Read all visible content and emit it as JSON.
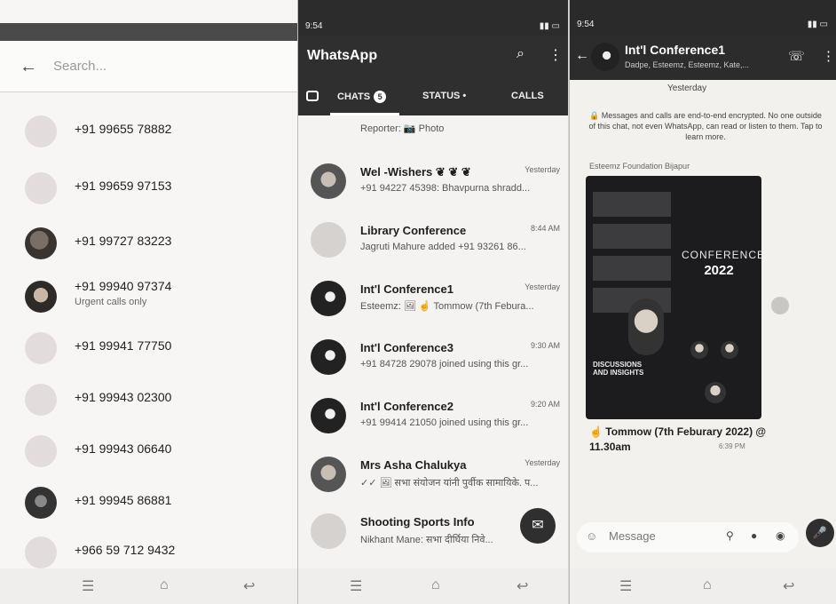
{
  "contacts_panel": {
    "search_placeholder": "Search...",
    "back_icon": "←",
    "contacts": [
      {
        "number": "+91 99655 78882",
        "subtitle": ""
      },
      {
        "number": "+91 99659 97153",
        "subtitle": ""
      },
      {
        "number": "+91 99727 83223",
        "subtitle": ""
      },
      {
        "number": "+91 99940 97374",
        "subtitle": "Urgent calls only"
      },
      {
        "number": "+91 99941 77750",
        "subtitle": ""
      },
      {
        "number": "+91 99943 02300",
        "subtitle": ""
      },
      {
        "number": "+91 99943 06640",
        "subtitle": ""
      },
      {
        "number": "+91 99945 86881",
        "subtitle": ""
      },
      {
        "number": "+966 59 712 9432",
        "subtitle": ""
      }
    ]
  },
  "chats_panel": {
    "status_time": "9:54",
    "app_title": "WhatsApp",
    "tabs": {
      "chats": "CHATS",
      "chats_badge": "5",
      "status": "STATUS •",
      "calls": "CALLS"
    },
    "chats": [
      {
        "name": "",
        "time": "",
        "last": "Reporter: 📷 Photo"
      },
      {
        "name": "Wel -Wishers ❦ ❦ ❦",
        "time": "Yesterday",
        "last": "+91 94227 45398: Bhavpurna shradd..."
      },
      {
        "name": "Library Conference",
        "time": "8:44 AM",
        "last": "Jagruti Mahure added +91 93261 86..."
      },
      {
        "name": "Int'l Conference1",
        "time": "Yesterday",
        "last": "Esteemz: 🖼 ☝ Tommow (7th Febura..."
      },
      {
        "name": "Int'l Conference3",
        "time": "9:30 AM",
        "last": "+91 84728 29078 joined using this gr..."
      },
      {
        "name": "Int'l Conference2",
        "time": "9:20 AM",
        "last": "+91 99414 21050 joined using this gr..."
      },
      {
        "name": "Mrs Asha Chalukya",
        "time": "Yesterday",
        "last": "✓✓ 🖼 सभा संयोजन यांनी पुर्वीक सामायिके. प..."
      },
      {
        "name": "Shooting Sports Info",
        "time": "",
        "last": "Nikhant Mane: सभा दीर्घिया निवे..."
      }
    ]
  },
  "chat_window": {
    "status_time": "9:54",
    "group_name": "Int'l Conference1",
    "members": "Dadpe, Esteemz, Esteemz, Kate,...",
    "day_label": "Yesterday",
    "e2e_notice": "🔒 Messages and calls are end-to-end encrypted. No one outside of this chat, not even WhatsApp, can read or listen to them. Tap to learn more.",
    "sender": "Esteemz Foundation Bijapur",
    "poster": {
      "conf": "CONFERENCE",
      "year": "2022",
      "discussions": "DISCUSSIONS AND INSIGHTS"
    },
    "caption": "☝ Tommow (7th Feburary 2022) @ 11.30am",
    "message_time": "6:39 PM",
    "composer_placeholder": "Message"
  }
}
